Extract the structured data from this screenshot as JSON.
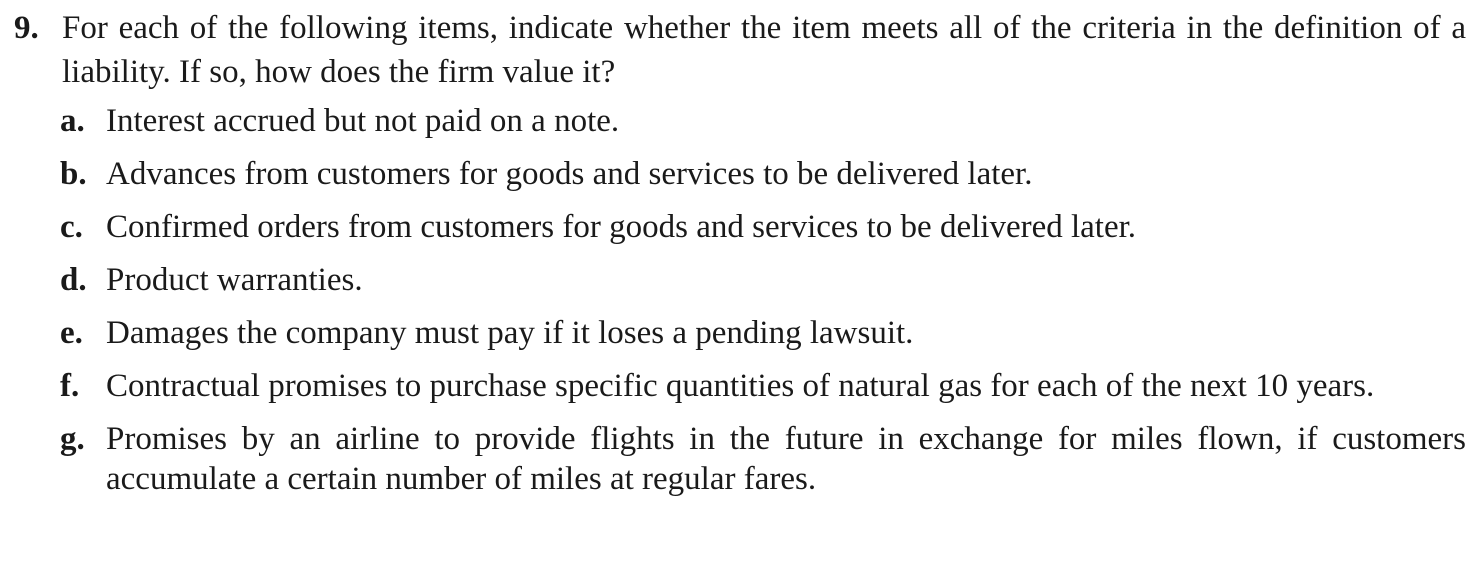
{
  "question": {
    "number": "9.",
    "text": "For each of the following items, indicate whether the item meets all of the criteria in the definition of a liability. If so, how does the firm value it?",
    "items": [
      {
        "letter": "a.",
        "text": "Interest accrued but not paid on a note."
      },
      {
        "letter": "b.",
        "text": "Advances from customers for goods and services to be delivered later."
      },
      {
        "letter": "c.",
        "text": "Confirmed orders from customers for goods and services to be delivered later."
      },
      {
        "letter": "d.",
        "text": "Product warranties."
      },
      {
        "letter": "e.",
        "text": "Damages the company must pay if it loses a pending lawsuit."
      },
      {
        "letter": "f.",
        "text": "Contractual promises to purchase specific quantities of natural gas for each of the next 10 years."
      },
      {
        "letter": "g.",
        "text": "Promises by an airline to provide flights in the future in exchange for miles flown, if customers accumulate a certain number of miles at regular fares."
      }
    ]
  }
}
